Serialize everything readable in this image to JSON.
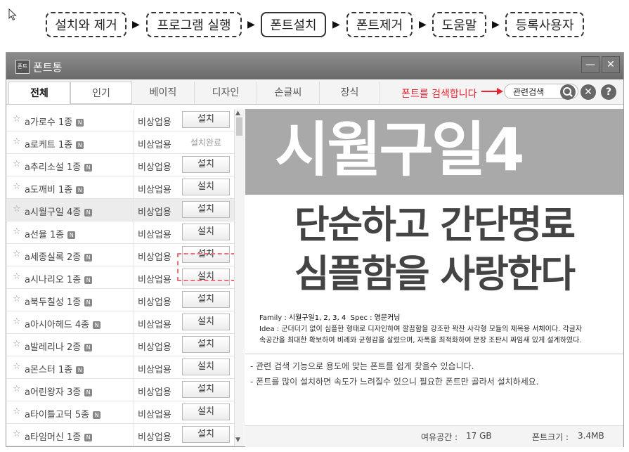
{
  "steps": [
    {
      "label": "설치와 제거"
    },
    {
      "label": "프로그램 실행"
    },
    {
      "label": "폰트설치"
    },
    {
      "label": "폰트제거"
    },
    {
      "label": "도움말"
    },
    {
      "label": "등록사용자"
    }
  ],
  "step_arrow": "▶",
  "window": {
    "title": "폰트통",
    "icon_text": "폰트",
    "minimize": "—",
    "close": "✕"
  },
  "tabs": [
    "전체",
    "인기",
    "베이직",
    "디자인",
    "손글씨",
    "장식"
  ],
  "search": {
    "hint": "폰트를 검색합니다",
    "value": "관련검색",
    "clear_label": "✕",
    "help_label": "?"
  },
  "font_list": [
    {
      "name": "a가로수 1종",
      "badge": "N",
      "license": "비상업용",
      "action": "설치"
    },
    {
      "name": "a로케트 1종",
      "badge": "N",
      "license": "비상업용",
      "action": "설치완료"
    },
    {
      "name": "a추리소설 1종",
      "badge": "N",
      "license": "비상업용",
      "action": "설치"
    },
    {
      "name": "a도깨비 1종",
      "badge": "N",
      "license": "비상업용",
      "action": "설치"
    },
    {
      "name": "a시월구일 4종",
      "badge": "N",
      "license": "비상업용",
      "action": "설치"
    },
    {
      "name": "a선율 1종",
      "badge": "N",
      "license": "비상업용",
      "action": "설치"
    },
    {
      "name": "a세종실록 2종",
      "badge": "N",
      "license": "비상업용",
      "action": "설치"
    },
    {
      "name": "a시나리오 1종",
      "badge": "N",
      "license": "비상업용",
      "action": "설치"
    },
    {
      "name": "a북두칠성 1종",
      "badge": "N",
      "license": "비상업용",
      "action": "설치"
    },
    {
      "name": "a아시아헤드 4종",
      "badge": "N",
      "license": "비상업용",
      "action": "설치"
    },
    {
      "name": "a발레리나 2종",
      "badge": "N",
      "license": "비상업용",
      "action": "설치"
    },
    {
      "name": "a몬스터 1종",
      "badge": "N",
      "license": "비상업용",
      "action": "설치"
    },
    {
      "name": "a어린왕자 3종",
      "badge": "N",
      "license": "비상업용",
      "action": "설치"
    },
    {
      "name": "a타이틀고딕 5종",
      "badge": "N",
      "license": "비상업용",
      "action": "설치"
    },
    {
      "name": "a타임머신 1종",
      "badge": "N",
      "license": "비상업용",
      "action": "설치"
    }
  ],
  "preview": {
    "banner_title": "시월구일4",
    "slogan_line1": "단순하고 간단명료",
    "slogan_line2": "심플함을 사랑한다",
    "family_label": "Family : ",
    "family_value": "시월구일1, 2, 3, 4",
    "spec_label": "Spec : ",
    "spec_value": "영문커닝",
    "idea_line1": "Idea : 군더더기 없이 심플한 형태로 디자인하여 깔끔함을 강조한 꽉찬 사각형 모듈의 제목용 서체이다. 각글자",
    "idea_line2": "속공간을 최대한 확보하여 비례와 균형감을 살렸으며, 자폭을 최적화하여 문장 조판시 짜임새 있게 설계하였다.",
    "note1": "- 관련 검색 기능으로 용도에 맞는 폰트를 쉽게 찾을수 있습니다.",
    "note2": "- 폰트를 많이 설치하면 속도가 느려질수 있으니 필요한 폰트만 골라서 설치하세요."
  },
  "status": {
    "free_space_label": "여유공간 :",
    "free_space_value": "17 GB",
    "font_size_label": "폰트크기 :",
    "font_size_value": "3.4MB"
  },
  "colors": {
    "hint": "#e8232e",
    "titlebar": "#7a7a7a",
    "banner": "#a9a9a9"
  }
}
